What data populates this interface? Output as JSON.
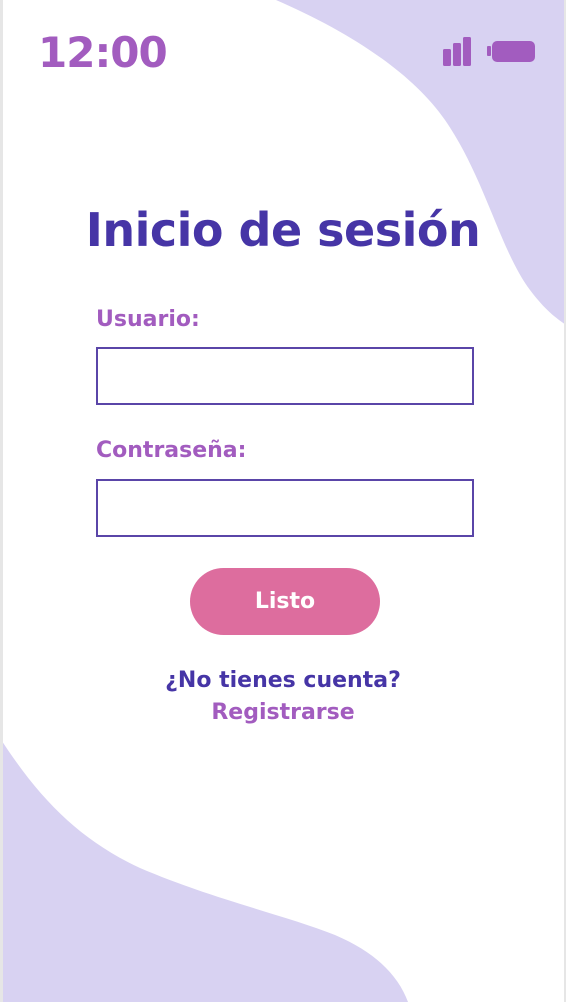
{
  "status_bar": {
    "time": "12:00",
    "icons": [
      "signal-icon",
      "battery-icon"
    ]
  },
  "login": {
    "title": "Inicio de sesión",
    "username_label": "Usuario:",
    "username_value": "",
    "password_label": "Contraseña:",
    "password_value": "",
    "submit_label": "Listo",
    "no_account_prompt": "¿No tienes cuenta?",
    "register_link": "Registrarse"
  },
  "colors": {
    "primary": "#4635a6",
    "accent": "#a25cbf",
    "button": "#dd6d9e",
    "background_blob": "#d8d2f2",
    "background": "#ffffff"
  }
}
